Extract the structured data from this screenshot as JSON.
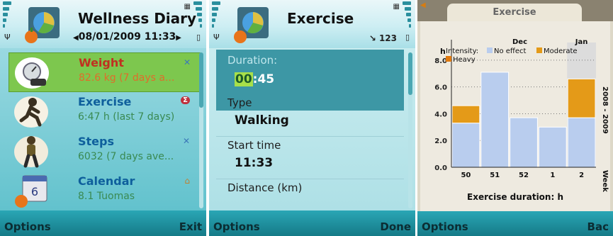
{
  "screen1": {
    "title": "Wellness Diary",
    "datetime": "08/01/2009 11:33",
    "nav_left": "◀",
    "nav_right": "▶",
    "items": [
      {
        "name": "Weight",
        "detail": "82.6 kg (7 days a...",
        "icon": "scale-icon",
        "badge": "sync-icon"
      },
      {
        "name": "Exercise",
        "detail": "6:47 h (last 7 days)",
        "icon": "runner-icon",
        "badge": "sigma-icon"
      },
      {
        "name": "Steps",
        "detail": "6032 (7 days ave...",
        "icon": "walker-icon",
        "badge": "sync-icon"
      },
      {
        "name": "Calendar",
        "detail": "8.1 Tuomas",
        "icon": "calendar-icon",
        "badge": "home-icon"
      }
    ],
    "soft_left": "Options",
    "soft_right": "Exit"
  },
  "screen2": {
    "title": "Exercise",
    "status": "123",
    "fields": [
      {
        "label": "Duration:",
        "value_hh": "00",
        "value_mm": ":45"
      },
      {
        "label": "Type",
        "value": "Walking"
      },
      {
        "label": "Start time",
        "value": "11:33"
      },
      {
        "label": "Distance (km)",
        "value": ""
      }
    ],
    "soft_left": "Options",
    "soft_right": "Done"
  },
  "screen3": {
    "tab_title": "Exercise",
    "soft_left": "Options",
    "soft_right": "Bac",
    "chart_data": {
      "type": "bar",
      "title": "Exercise duration: h",
      "ylabel": "h",
      "xlabel": "Week",
      "year_label": "2008 - 2009",
      "month_labels": [
        "Dec",
        "Jan"
      ],
      "categories": [
        "50",
        "51",
        "52",
        "1",
        "2"
      ],
      "yticks": [
        "0.0",
        "2.0",
        "4.0",
        "6.0",
        "8.0"
      ],
      "ylim": [
        0,
        9
      ],
      "legend_title": "Intensity:",
      "series": [
        {
          "name": "No effect",
          "color": "#b9cdee",
          "values": [
            3.3,
            7.1,
            3.7,
            3.0,
            3.7
          ]
        },
        {
          "name": "Moderate",
          "color": "#e49a18",
          "values": [
            1.3,
            0,
            0,
            0,
            2.9
          ]
        },
        {
          "name": "Heavy",
          "color": "#e07a10",
          "values": [
            0,
            0,
            0,
            0,
            0
          ]
        }
      ],
      "grid": true,
      "legend_position": "top-left"
    }
  }
}
